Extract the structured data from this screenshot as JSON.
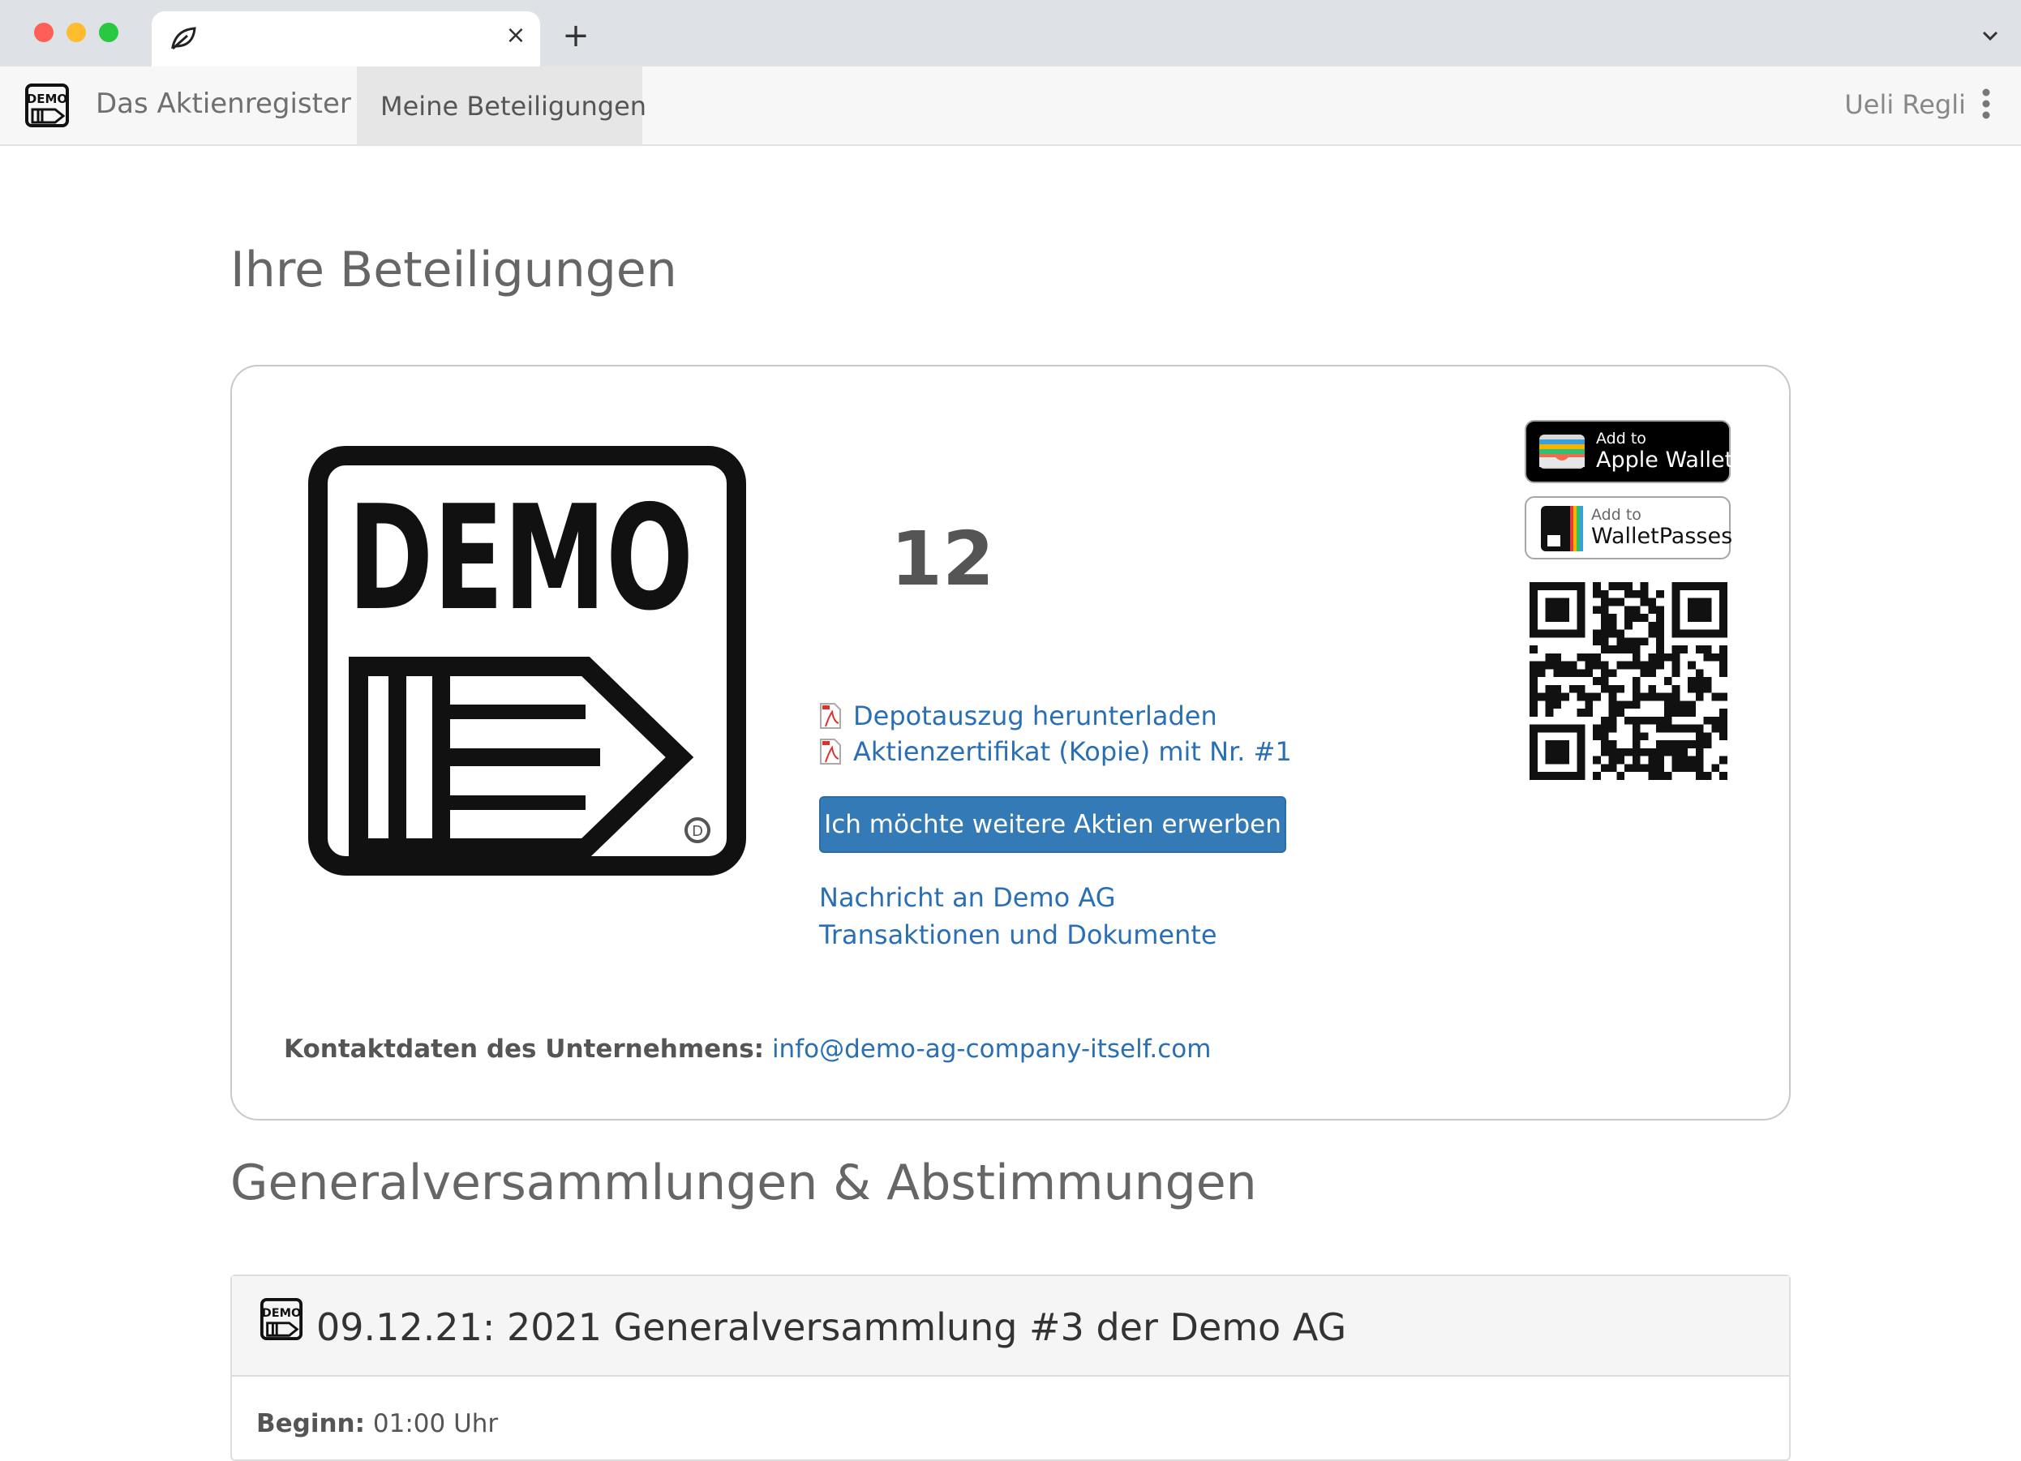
{
  "browser": {
    "tab_title": "",
    "favicon": "leaf-icon",
    "close_glyph": "×",
    "new_tab_glyph": "+"
  },
  "navbar": {
    "brand": "Das Aktienregister",
    "active_item": "Meine Beteiligungen",
    "user": "Ueli Regli"
  },
  "holdings": {
    "heading": "Ihre Beteiligungen",
    "share_count": "12",
    "links": {
      "statement": "Depotauszug herunterladen",
      "certificate": "Aktienzertifikat (Kopie) mit Nr. #1",
      "message": "Nachricht an Demo AG",
      "transactions": "Transaktionen und Dokumente"
    },
    "buy_button": "Ich möchte weitere Aktien erwerben",
    "contact_label": "Kontaktdaten des Unternehmens:",
    "contact_email": "info@demo-ag-company-itself.com",
    "wallet": {
      "apple_small": "Add to",
      "apple_big": "Apple Wallet",
      "passes_small": "Add to",
      "passes_big": "WalletPasses"
    },
    "logo": {
      "text": "DEMO"
    }
  },
  "meetings": {
    "heading": "Generalversammlungen & Abstimmungen",
    "items": [
      {
        "title": "09.12.21: 2021 Generalversammlung #3 der Demo AG",
        "start_label": "Beginn:",
        "start_value": "01:00 Uhr"
      }
    ]
  },
  "colors": {
    "link": "#2a6fb4",
    "primary_button": "#337ab7",
    "navbar_bg": "#f7f7f7"
  }
}
